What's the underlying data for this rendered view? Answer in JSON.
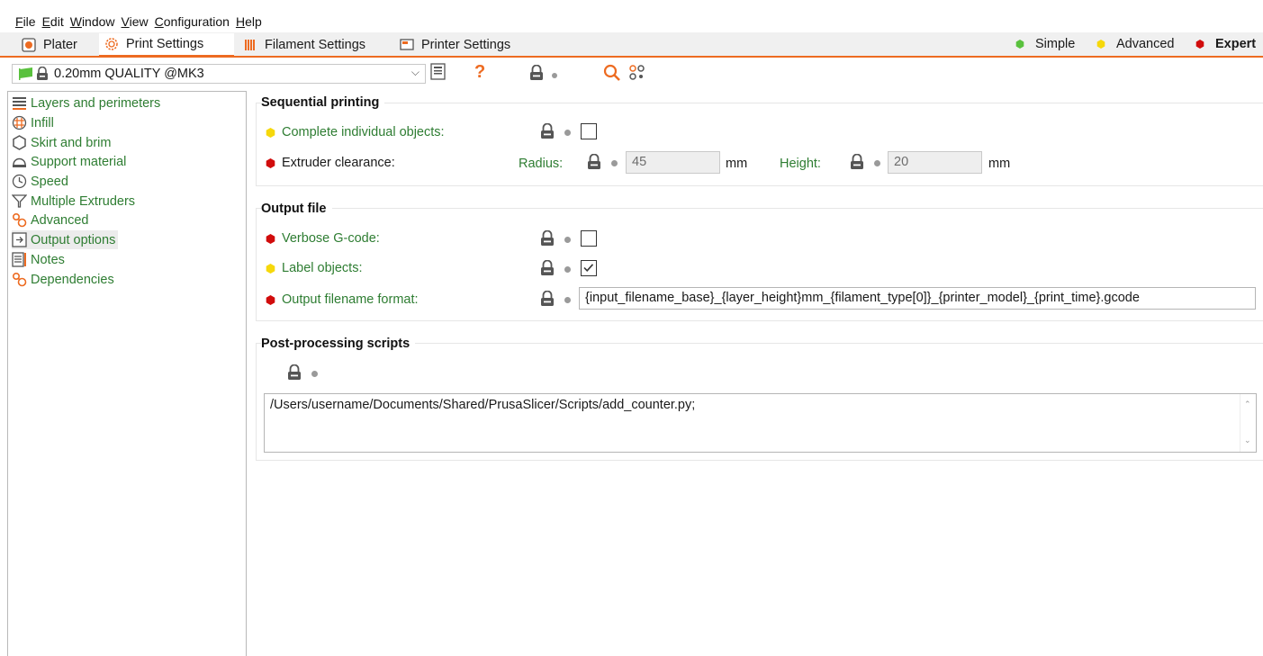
{
  "menu": [
    {
      "prefix": "",
      "u": "F",
      "rest": "ile"
    },
    {
      "prefix": "",
      "u": "E",
      "rest": "dit"
    },
    {
      "prefix": "",
      "u": "W",
      "rest": "indow"
    },
    {
      "prefix": "",
      "u": "V",
      "rest": "iew"
    },
    {
      "prefix": "",
      "u": "C",
      "rest": "onfiguration"
    },
    {
      "prefix": "",
      "u": "H",
      "rest": "elp"
    }
  ],
  "tabs": {
    "plater": "Plater",
    "print_settings": "Print Settings",
    "filament_settings": "Filament Settings",
    "printer_settings": "Printer Settings",
    "active": "print_settings"
  },
  "modes": {
    "simple": "Simple",
    "advanced": "Advanced",
    "expert": "Expert"
  },
  "preset": {
    "name": "0.20mm QUALITY @MK3"
  },
  "sidebar": {
    "items": [
      {
        "label": "Layers and perimeters",
        "icon": "layers-icon"
      },
      {
        "label": "Infill",
        "icon": "infill-icon"
      },
      {
        "label": "Skirt and brim",
        "icon": "skirt-icon"
      },
      {
        "label": "Support material",
        "icon": "support-icon"
      },
      {
        "label": "Speed",
        "icon": "speed-icon"
      },
      {
        "label": "Multiple Extruders",
        "icon": "extruders-icon"
      },
      {
        "label": "Advanced",
        "icon": "advanced-icon"
      },
      {
        "label": "Output options",
        "icon": "output-icon"
      },
      {
        "label": "Notes",
        "icon": "notes-icon"
      },
      {
        "label": "Dependencies",
        "icon": "dependencies-icon"
      }
    ],
    "selected": "Output options"
  },
  "sequential": {
    "title": "Sequential printing",
    "complete_label": "Complete individual objects:",
    "complete_checked": false,
    "clearance_label": "Extruder clearance:",
    "radius_label": "Radius:",
    "radius_value": "45",
    "radius_unit": "mm",
    "height_label": "Height:",
    "height_value": "20",
    "height_unit": "mm"
  },
  "output": {
    "title": "Output file",
    "verbose_label": "Verbose G-code:",
    "verbose_checked": false,
    "label_objects_label": "Label objects:",
    "label_objects_checked": true,
    "filename_label": "Output filename format:",
    "filename_value": "{input_filename_base}_{layer_height}mm_{filament_type[0]}_{printer_model}_{print_time}.gcode"
  },
  "postproc": {
    "title": "Post-processing scripts",
    "scripts": "/Users/username/Documents/Shared/PrusaSlicer/Scripts/add_counter.py;"
  },
  "colors": {
    "accent": "#ed6b21",
    "simple": "#59c13d",
    "advanced": "#f6d80b",
    "expert": "#d10c0c",
    "label_green": "#2e7d32"
  }
}
